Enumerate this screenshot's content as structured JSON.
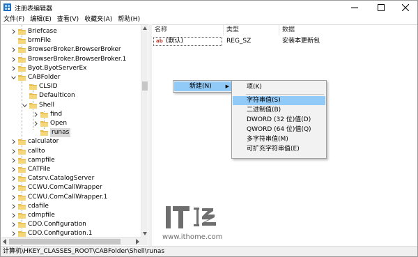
{
  "window": {
    "title": "注册表编辑器",
    "buttons": {
      "minimize": "minimize-icon",
      "maximize": "maximize-icon",
      "close": "close-icon"
    }
  },
  "menubar": {
    "items": [
      "文件(F)",
      "编辑(E)",
      "查看(V)",
      "收藏夹(A)",
      "帮助(H)"
    ]
  },
  "tree": {
    "items": [
      {
        "label": "Briefcase",
        "level": 0,
        "chevron": "right"
      },
      {
        "label": "brmFile",
        "level": 0,
        "chevron": "none"
      },
      {
        "label": "BrowserBroker.BrowserBroker",
        "level": 0,
        "chevron": "right"
      },
      {
        "label": "BrowserBroker.BrowserBroker.1",
        "level": 0,
        "chevron": "right"
      },
      {
        "label": "Byot.ByotServerEx",
        "level": 0,
        "chevron": "right"
      },
      {
        "label": "CABFolder",
        "level": 0,
        "chevron": "down"
      },
      {
        "label": "CLSID",
        "level": 1,
        "chevron": "none"
      },
      {
        "label": "DefaultIcon",
        "level": 1,
        "chevron": "none"
      },
      {
        "label": "Shell",
        "level": 1,
        "chevron": "down"
      },
      {
        "label": "find",
        "level": 2,
        "chevron": "right"
      },
      {
        "label": "Open",
        "level": 2,
        "chevron": "right"
      },
      {
        "label": "runas",
        "level": 2,
        "chevron": "none",
        "selected": true
      },
      {
        "label": "calculator",
        "level": 0,
        "chevron": "right"
      },
      {
        "label": "callto",
        "level": 0,
        "chevron": "right"
      },
      {
        "label": "campfile",
        "level": 0,
        "chevron": "right"
      },
      {
        "label": "CATFile",
        "level": 0,
        "chevron": "right"
      },
      {
        "label": "Catsrv.CatalogServer",
        "level": 0,
        "chevron": "right"
      },
      {
        "label": "CCWU.ComCallWrapper",
        "level": 0,
        "chevron": "right"
      },
      {
        "label": "CCWU.ComCallWrapper.1",
        "level": 0,
        "chevron": "right"
      },
      {
        "label": "cdafile",
        "level": 0,
        "chevron": "right"
      },
      {
        "label": "cdmpfile",
        "level": 0,
        "chevron": "right"
      },
      {
        "label": "CDO.Configuration",
        "level": 0,
        "chevron": "right"
      },
      {
        "label": "CDO.Configuration.1",
        "level": 0,
        "chevron": "right"
      }
    ]
  },
  "values": {
    "columns": {
      "name": "名称",
      "type": "类型",
      "data": "数据"
    },
    "rows": [
      {
        "icon": "string-value-icon",
        "icon_text": "ab",
        "name": "(默认)",
        "type": "REG_SZ",
        "data": "安装本更新包"
      }
    ]
  },
  "context_menu": {
    "new_label": "新建(N)",
    "submenu": [
      "项(K)",
      "字符串值(S)",
      "二进制值(B)",
      "DWORD (32 位)值(D)",
      "QWORD (64 位)值(Q)",
      "多字符串值(M)",
      "可扩充字符串值(E)"
    ],
    "hovered_index": 1
  },
  "watermark": {
    "logo": "ithome-logo",
    "url": "www.ithome.com"
  },
  "statusbar": {
    "path": "计算机\\HKEY_CLASSES_ROOT\\CABFolder\\Shell\\runas"
  },
  "colors": {
    "highlight": "#91c9f7",
    "selected_tree": "#d9d9d9",
    "folder": "#e8b844",
    "menu_bg": "#f2f2f2"
  }
}
